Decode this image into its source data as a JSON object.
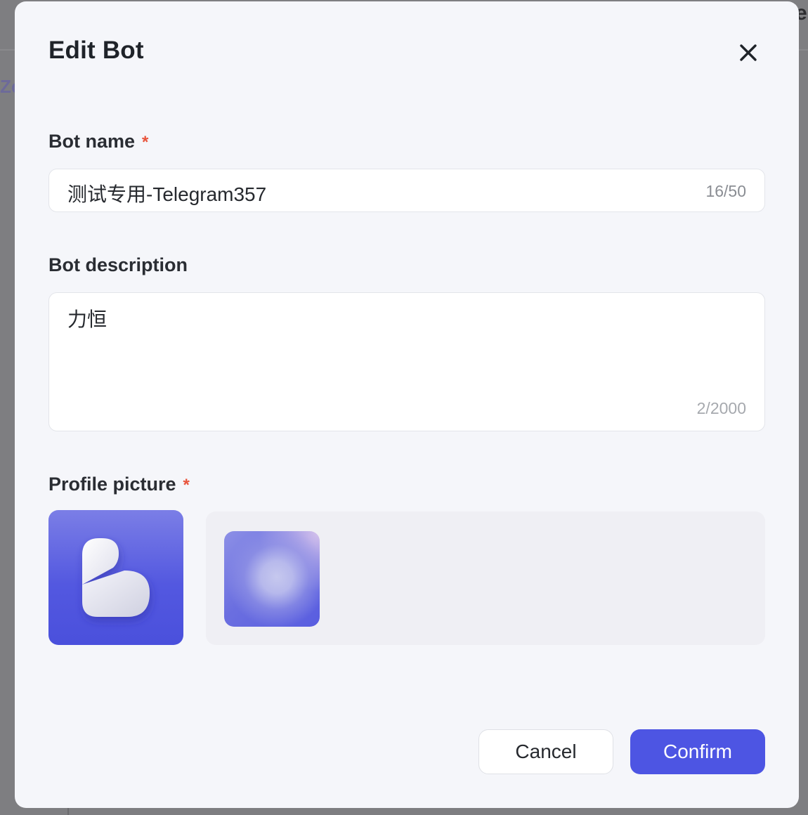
{
  "background": {
    "left_fragment": "Zc",
    "right_fragment": "e"
  },
  "modal": {
    "title": "Edit Bot",
    "close_icon": "close-icon"
  },
  "bot_name": {
    "label": "Bot name",
    "required_mark": "*",
    "value": "测试专用-Telegram357",
    "counter": "16/50"
  },
  "bot_description": {
    "label": "Bot description",
    "value": "力恒",
    "counter": "2/2000"
  },
  "profile_picture": {
    "label": "Profile picture",
    "required_mark": "*",
    "selected_icon": "bot-logo-b-icon",
    "options": [
      {
        "icon": "gradient-avatar-option"
      }
    ]
  },
  "footer": {
    "cancel_label": "Cancel",
    "confirm_label": "Confirm"
  },
  "colors": {
    "accent": "#4d55e3",
    "required": "#e8543c",
    "modal_bg": "#f5f6fa"
  }
}
